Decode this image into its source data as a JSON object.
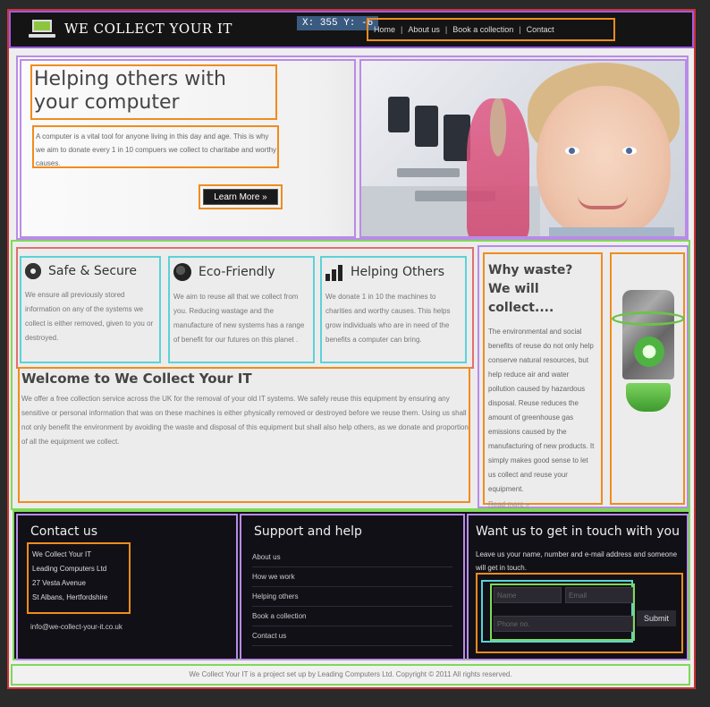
{
  "header": {
    "logo_text": "WE COLLECT YOUR IT",
    "coords_readout": "X: 355 Y: -6",
    "nav": [
      "Home",
      "About us",
      "Book a collection",
      "Contact"
    ],
    "separator": "|"
  },
  "hero": {
    "title": "Helping others with your computer",
    "text": "A computer is a vital tool for anyone living in this day and age. This is why we aim to donate every 1 in 10 compuers we collect to charitabe and worthy causes.",
    "button": "Learn More »"
  },
  "features": [
    {
      "title": "Safe & Secure",
      "icon": "gear-icon",
      "text": "We ensure all previously stored information on any of the systems we collect is either removed, given to you or destroyed."
    },
    {
      "title": "Eco-Friendly",
      "icon": "globe-icon",
      "text": "We aim to reuse all that we collect from you. Reducing wastage and the manufacture of new systems has a range of benefit for our futures on this planet ."
    },
    {
      "title": "Helping Others",
      "icon": "bar-chart-icon",
      "text": "We donate 1 in 10 the machines to charities and worthy causes. This helps grow individuals who are in need of the benefits a computer can bring."
    }
  ],
  "welcome": {
    "title": "Welcome to We Collect Your IT",
    "text": "We offer a free collection service across the UK for the removal of your old IT systems. We safely reuse this equipment by ensuring any sensitive or personal information that was on these machines is either physically removed or destroyed before we reuse them. Using us shall not only benefit the environment by avoiding the waste and disposal of this equipment but shall also help others, as we donate and proportion of all the equipment we collect."
  },
  "why": {
    "title": "Why waste? We will collect....",
    "text": "The environmental and social benefits of reuse do not only help conserve natural resources, but help reduce air and water pollution caused by hazardous disposal. Reuse reduces the amount of greenhouse gas emissions caused by the manufacturing of new products. It simply makes good sense to let us collect and reuse your equipment.",
    "link": "Read more »"
  },
  "footer": {
    "contact": {
      "title": "Contact us",
      "address": [
        "We Collect Your IT",
        "Leading Computers Ltd",
        "27 Vesta Avenue",
        "St Albans, Hertfordshire"
      ],
      "email": "info@we-collect-your-it.co.uk"
    },
    "support": {
      "title": "Support and help",
      "links": [
        "About us",
        "How we work",
        "Helping others",
        "Book a collection",
        "Contact us"
      ]
    },
    "getintouch": {
      "title": "Want us to get in touch with you",
      "text": "Leave us your name, number and e-mail address and someone will get in touch.",
      "name_placeholder": "Name",
      "email_placeholder": "Email",
      "phone_placeholder": "Phone no.",
      "submit": "Submit"
    }
  },
  "copyright": "We Collect Your IT is a project set up by Leading Computers Ltd. Copyright © 2011 All rights reserved."
}
